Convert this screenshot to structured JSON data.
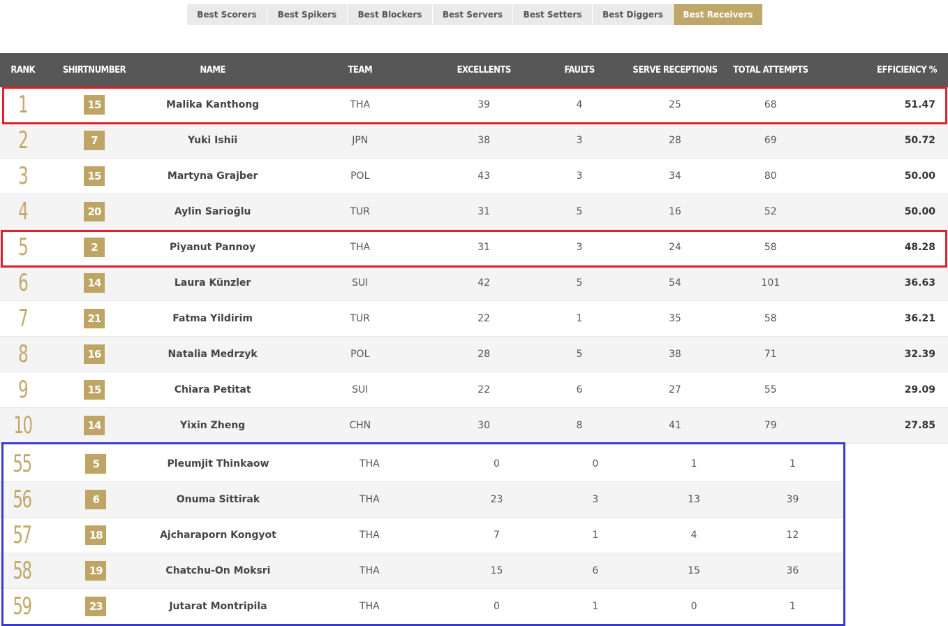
{
  "tabs": [
    {
      "label": "Best Scorers",
      "active": false
    },
    {
      "label": "Best Spikers",
      "active": false
    },
    {
      "label": "Best Blockers",
      "active": false
    },
    {
      "label": "Best Servers",
      "active": false
    },
    {
      "label": "Best Setters",
      "active": false
    },
    {
      "label": "Best Diggers",
      "active": false
    },
    {
      "label": "Best Receivers",
      "active": true
    }
  ],
  "columns": {
    "rank": "RANK",
    "shirt": "SHIRTNUMBER",
    "name": "NAME",
    "team": "TEAM",
    "excellents": "EXCELLENTS",
    "faults": "FAULTS",
    "serve_receptions": "SERVE RECEPTIONS",
    "total_attempts": "TOTAL ATTEMPTS",
    "efficiency": "EFFICIENCY %"
  },
  "top_rows": [
    {
      "rank": "1",
      "shirt": "15",
      "name": "Malika Kanthong",
      "team": "THA",
      "excellents": "39",
      "faults": "4",
      "serve_receptions": "25",
      "total_attempts": "68",
      "efficiency": "51.47"
    },
    {
      "rank": "2",
      "shirt": "7",
      "name": "Yuki Ishii",
      "team": "JPN",
      "excellents": "38",
      "faults": "3",
      "serve_receptions": "28",
      "total_attempts": "69",
      "efficiency": "50.72"
    },
    {
      "rank": "3",
      "shirt": "15",
      "name": "Martyna Grajber",
      "team": "POL",
      "excellents": "43",
      "faults": "3",
      "serve_receptions": "34",
      "total_attempts": "80",
      "efficiency": "50.00"
    },
    {
      "rank": "4",
      "shirt": "20",
      "name": "Aylin Sarioğlu",
      "team": "TUR",
      "excellents": "31",
      "faults": "5",
      "serve_receptions": "16",
      "total_attempts": "52",
      "efficiency": "50.00"
    },
    {
      "rank": "5",
      "shirt": "2",
      "name": "Piyanut Pannoy",
      "team": "THA",
      "excellents": "31",
      "faults": "3",
      "serve_receptions": "24",
      "total_attempts": "58",
      "efficiency": "48.28"
    },
    {
      "rank": "6",
      "shirt": "14",
      "name": "Laura Künzler",
      "team": "SUI",
      "excellents": "42",
      "faults": "5",
      "serve_receptions": "54",
      "total_attempts": "101",
      "efficiency": "36.63"
    },
    {
      "rank": "7",
      "shirt": "21",
      "name": "Fatma Yildirim",
      "team": "TUR",
      "excellents": "22",
      "faults": "1",
      "serve_receptions": "35",
      "total_attempts": "58",
      "efficiency": "36.21"
    },
    {
      "rank": "8",
      "shirt": "16",
      "name": "Natalia Medrzyk",
      "team": "POL",
      "excellents": "28",
      "faults": "5",
      "serve_receptions": "38",
      "total_attempts": "71",
      "efficiency": "32.39"
    },
    {
      "rank": "9",
      "shirt": "15",
      "name": "Chiara Petitat",
      "team": "SUI",
      "excellents": "22",
      "faults": "6",
      "serve_receptions": "27",
      "total_attempts": "55",
      "efficiency": "29.09"
    },
    {
      "rank": "10",
      "shirt": "14",
      "name": "Yixin Zheng",
      "team": "CHN",
      "excellents": "30",
      "faults": "8",
      "serve_receptions": "41",
      "total_attempts": "79",
      "efficiency": "27.85"
    }
  ],
  "bottom_rows": [
    {
      "rank": "55",
      "shirt": "5",
      "name": "Pleumjit Thinkaow",
      "team": "THA",
      "excellents": "0",
      "faults": "0",
      "serve_receptions": "1",
      "total_attempts": "1"
    },
    {
      "rank": "56",
      "shirt": "6",
      "name": "Onuma Sittirak",
      "team": "THA",
      "excellents": "23",
      "faults": "3",
      "serve_receptions": "13",
      "total_attempts": "39"
    },
    {
      "rank": "57",
      "shirt": "18",
      "name": "Ajcharaporn Kongyot",
      "team": "THA",
      "excellents": "7",
      "faults": "1",
      "serve_receptions": "4",
      "total_attempts": "12"
    },
    {
      "rank": "58",
      "shirt": "19",
      "name": "Chatchu-On Moksri",
      "team": "THA",
      "excellents": "15",
      "faults": "6",
      "serve_receptions": "15",
      "total_attempts": "36"
    },
    {
      "rank": "59",
      "shirt": "23",
      "name": "Jutarat Montripila",
      "team": "THA",
      "excellents": "0",
      "faults": "1",
      "serve_receptions": "0",
      "total_attempts": "1"
    }
  ],
  "colors": {
    "accent_gold": "#bfa565",
    "header_bg": "#575757",
    "highlight_red": "#e0202a",
    "highlight_blue": "#3a3ad0"
  }
}
